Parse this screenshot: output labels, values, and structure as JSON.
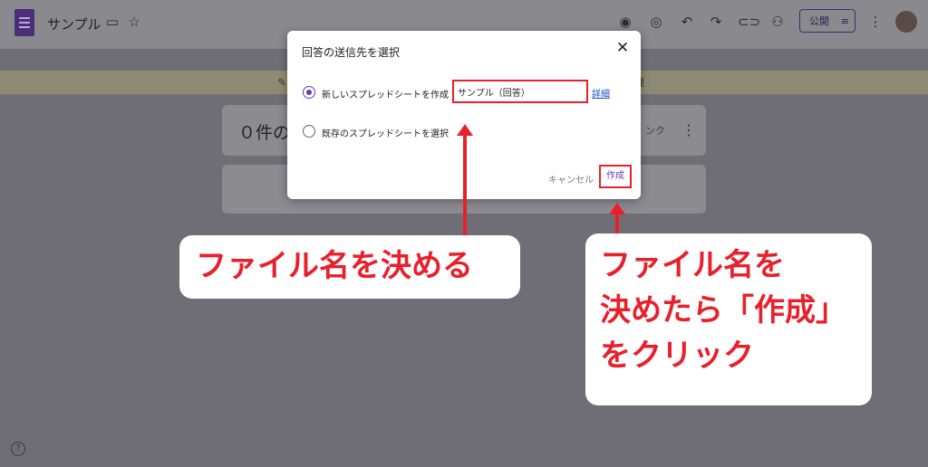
{
  "app": {
    "doc_title": "サンプル",
    "publish_label": "公開",
    "form_heading": "０件の",
    "card_link_fragment": "ンク",
    "banner_text_fragment": "理"
  },
  "dialog": {
    "title": "回答の送信先を選択",
    "option_new_label": "新しいスプレッドシートを作成",
    "option_new_value": "サンプル（回答）",
    "details_link": "詳細",
    "option_existing_label": "既存のスプレッドシートを選択",
    "cancel_label": "キャンセル",
    "create_label": "作成"
  },
  "annotations": {
    "callout_1": "ファイル名を決める",
    "callout_2_lines": [
      "ファイル名を",
      "決めたら「作成」",
      "をクリック"
    ]
  },
  "colors": {
    "accent_purple": "#673ab7",
    "annotation_red": "#e8202b",
    "link_blue": "#1a4fc5"
  },
  "icons": {
    "forms_logo": "google-forms-icon",
    "folder": "folder-icon",
    "star": "star-icon",
    "palette": "palette-icon",
    "preview": "eye-icon",
    "undo": "undo-icon",
    "redo": "redo-icon",
    "link": "link-icon",
    "add_collaborator": "add-person-icon",
    "settings_tune": "tune-icon",
    "more": "more-vert-icon",
    "close": "close-icon",
    "help": "help-icon"
  }
}
